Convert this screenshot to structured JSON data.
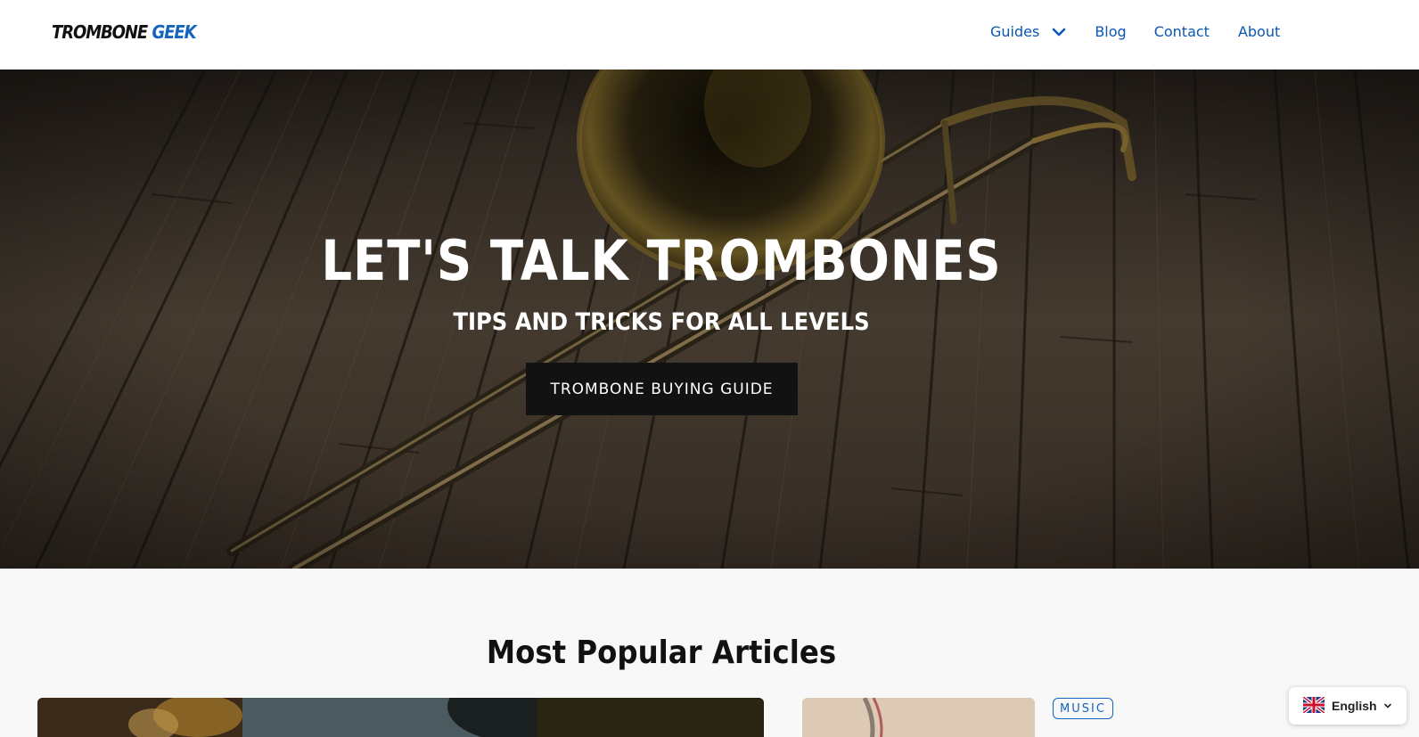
{
  "header": {
    "logo_part1": "TROMBONE",
    "logo_part2": "GEEK",
    "nav": {
      "guides": "Guides",
      "blog": "Blog",
      "contact": "Contact",
      "about": "About"
    }
  },
  "hero": {
    "title": "LET'S TALK TROMBONES",
    "subtitle": "TIPS AND TRICKS FOR ALL LEVELS",
    "cta": "TROMBONE BUYING GUIDE"
  },
  "popular": {
    "heading": "Most Popular Articles",
    "badge": "MUSIC"
  },
  "language": {
    "label": "English",
    "flag_icon": "uk-flag-icon"
  },
  "colors": {
    "accent": "#1565c0",
    "nav_link": "#0b57b3",
    "button_bg": "#121212"
  }
}
